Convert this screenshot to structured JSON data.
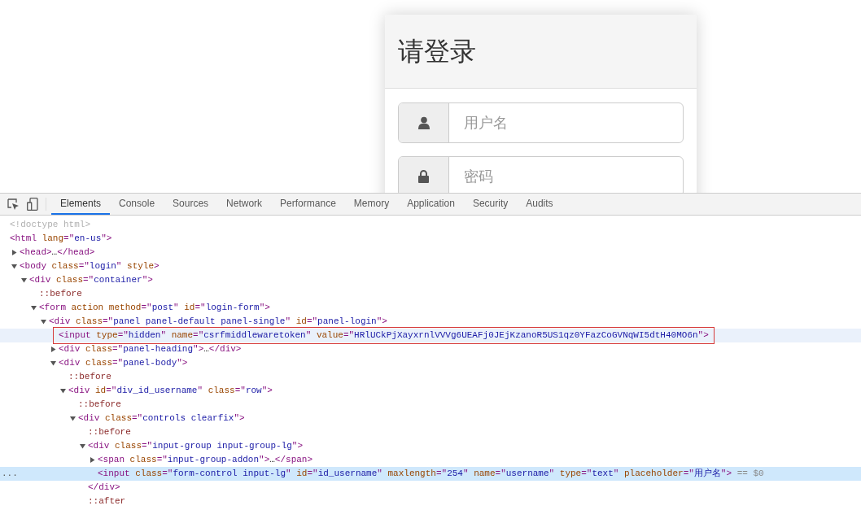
{
  "page": {
    "panel": {
      "title": "请登录",
      "fields": [
        {
          "kind": "user",
          "placeholder": "用户名"
        },
        {
          "kind": "lock",
          "placeholder": "密码"
        }
      ]
    }
  },
  "devtools": {
    "tabs": [
      {
        "label": "Elements",
        "selected": true
      },
      {
        "label": "Console",
        "selected": false
      },
      {
        "label": "Sources",
        "selected": false
      },
      {
        "label": "Network",
        "selected": false
      },
      {
        "label": "Performance",
        "selected": false
      },
      {
        "label": "Memory",
        "selected": false
      },
      {
        "label": "Application",
        "selected": false
      },
      {
        "label": "Security",
        "selected": false
      },
      {
        "label": "Audits",
        "selected": false
      }
    ],
    "tree": [
      {
        "segments": [
          {
            "kind": "comment",
            "text": "<!doctype html>"
          }
        ],
        "selected": false,
        "hovered": false,
        "outlined": false
      },
      {
        "segments": [
          {
            "kind": "tag",
            "text": "<html"
          },
          {
            "kind": "attr",
            "text": " lang"
          },
          {
            "kind": "tag",
            "text": "=\""
          },
          {
            "kind": "val",
            "text": "en-us"
          },
          {
            "kind": "tag",
            "text": "\">"
          }
        ],
        "selected": false,
        "hovered": false,
        "outlined": false,
        "children": [
          {
            "segments": [
              {
                "kind": "tag",
                "text": "<head>"
              },
              {
                "kind": "text",
                "text": "…"
              },
              {
                "kind": "tag",
                "text": "</head>"
              }
            ],
            "expanded": false,
            "selected": false,
            "hovered": false,
            "outlined": false
          },
          {
            "segments": [
              {
                "kind": "tag",
                "text": "<body"
              },
              {
                "kind": "attr",
                "text": " class"
              },
              {
                "kind": "tag",
                "text": "=\""
              },
              {
                "kind": "val",
                "text": "login"
              },
              {
                "kind": "tag",
                "text": "\""
              },
              {
                "kind": "attr",
                "text": " style"
              },
              {
                "kind": "tag",
                "text": ">"
              }
            ],
            "expanded": true,
            "selected": false,
            "hovered": false,
            "outlined": false,
            "children": [
              {
                "segments": [
                  {
                    "kind": "tag",
                    "text": "<div"
                  },
                  {
                    "kind": "attr",
                    "text": " class"
                  },
                  {
                    "kind": "tag",
                    "text": "=\""
                  },
                  {
                    "kind": "val",
                    "text": "container"
                  },
                  {
                    "kind": "tag",
                    "text": "\">"
                  }
                ],
                "expanded": true,
                "selected": false,
                "hovered": false,
                "outlined": false,
                "children": [
                  {
                    "segments": [
                      {
                        "kind": "pseudo",
                        "text": "::before"
                      }
                    ],
                    "selected": false,
                    "hovered": false,
                    "outlined": false
                  },
                  {
                    "segments": [
                      {
                        "kind": "tag",
                        "text": "<form"
                      },
                      {
                        "kind": "attr",
                        "text": " action method"
                      },
                      {
                        "kind": "tag",
                        "text": "=\""
                      },
                      {
                        "kind": "val",
                        "text": "post"
                      },
                      {
                        "kind": "tag",
                        "text": "\""
                      },
                      {
                        "kind": "attr",
                        "text": " id"
                      },
                      {
                        "kind": "tag",
                        "text": "=\""
                      },
                      {
                        "kind": "val",
                        "text": "login-form"
                      },
                      {
                        "kind": "tag",
                        "text": "\">"
                      }
                    ],
                    "expanded": true,
                    "selected": false,
                    "hovered": false,
                    "outlined": false,
                    "children": [
                      {
                        "segments": [
                          {
                            "kind": "tag",
                            "text": "<div"
                          },
                          {
                            "kind": "attr",
                            "text": " class"
                          },
                          {
                            "kind": "tag",
                            "text": "=\""
                          },
                          {
                            "kind": "val",
                            "text": "panel panel-default panel-single"
                          },
                          {
                            "kind": "tag",
                            "text": "\""
                          },
                          {
                            "kind": "attr",
                            "text": " id"
                          },
                          {
                            "kind": "tag",
                            "text": "=\""
                          },
                          {
                            "kind": "val",
                            "text": "panel-login"
                          },
                          {
                            "kind": "tag",
                            "text": "\">"
                          }
                        ],
                        "expanded": true,
                        "selected": false,
                        "hovered": false,
                        "outlined": false,
                        "children": [
                          {
                            "segments": [
                              {
                                "kind": "tag",
                                "text": "<input"
                              },
                              {
                                "kind": "attr",
                                "text": " type"
                              },
                              {
                                "kind": "tag",
                                "text": "=\""
                              },
                              {
                                "kind": "val",
                                "text": "hidden"
                              },
                              {
                                "kind": "tag",
                                "text": "\""
                              },
                              {
                                "kind": "attr",
                                "text": " name"
                              },
                              {
                                "kind": "tag",
                                "text": "=\""
                              },
                              {
                                "kind": "val",
                                "text": "csrfmiddlewaretoken"
                              },
                              {
                                "kind": "tag",
                                "text": "\""
                              },
                              {
                                "kind": "attr",
                                "text": " value"
                              },
                              {
                                "kind": "tag",
                                "text": "=\""
                              },
                              {
                                "kind": "val",
                                "text": "HRlUCkPjXayxrnlVVVg6UEAFj0JEjKzanoR5US1qz0YFazCoGVNqWI5dtH40MO6n"
                              },
                              {
                                "kind": "tag",
                                "text": "\">"
                              }
                            ],
                            "selected": false,
                            "hovered": true,
                            "outlined": true
                          },
                          {
                            "segments": [
                              {
                                "kind": "tag",
                                "text": "<div"
                              },
                              {
                                "kind": "attr",
                                "text": " class"
                              },
                              {
                                "kind": "tag",
                                "text": "=\""
                              },
                              {
                                "kind": "val",
                                "text": "panel-heading"
                              },
                              {
                                "kind": "tag",
                                "text": "\">"
                              },
                              {
                                "kind": "text",
                                "text": "…"
                              },
                              {
                                "kind": "tag",
                                "text": "</div>"
                              }
                            ],
                            "expanded": false,
                            "selected": false,
                            "hovered": false,
                            "outlined": false
                          },
                          {
                            "segments": [
                              {
                                "kind": "tag",
                                "text": "<div"
                              },
                              {
                                "kind": "attr",
                                "text": " class"
                              },
                              {
                                "kind": "tag",
                                "text": "=\""
                              },
                              {
                                "kind": "val",
                                "text": "panel-body"
                              },
                              {
                                "kind": "tag",
                                "text": "\">"
                              }
                            ],
                            "expanded": true,
                            "selected": false,
                            "hovered": false,
                            "outlined": false,
                            "children": [
                              {
                                "segments": [
                                  {
                                    "kind": "pseudo",
                                    "text": "::before"
                                  }
                                ],
                                "selected": false,
                                "hovered": false,
                                "outlined": false
                              },
                              {
                                "segments": [
                                  {
                                    "kind": "tag",
                                    "text": "<div"
                                  },
                                  {
                                    "kind": "attr",
                                    "text": " id"
                                  },
                                  {
                                    "kind": "tag",
                                    "text": "=\""
                                  },
                                  {
                                    "kind": "val",
                                    "text": "div_id_username"
                                  },
                                  {
                                    "kind": "tag",
                                    "text": "\""
                                  },
                                  {
                                    "kind": "attr",
                                    "text": " class"
                                  },
                                  {
                                    "kind": "tag",
                                    "text": "=\""
                                  },
                                  {
                                    "kind": "val",
                                    "text": "row"
                                  },
                                  {
                                    "kind": "tag",
                                    "text": "\">"
                                  }
                                ],
                                "expanded": true,
                                "selected": false,
                                "hovered": false,
                                "outlined": false,
                                "children": [
                                  {
                                    "segments": [
                                      {
                                        "kind": "pseudo",
                                        "text": "::before"
                                      }
                                    ],
                                    "selected": false,
                                    "hovered": false,
                                    "outlined": false
                                  },
                                  {
                                    "segments": [
                                      {
                                        "kind": "tag",
                                        "text": "<div"
                                      },
                                      {
                                        "kind": "attr",
                                        "text": " class"
                                      },
                                      {
                                        "kind": "tag",
                                        "text": "=\""
                                      },
                                      {
                                        "kind": "val",
                                        "text": "controls clearfix"
                                      },
                                      {
                                        "kind": "tag",
                                        "text": "\">"
                                      }
                                    ],
                                    "expanded": true,
                                    "selected": false,
                                    "hovered": false,
                                    "outlined": false,
                                    "children": [
                                      {
                                        "segments": [
                                          {
                                            "kind": "pseudo",
                                            "text": "::before"
                                          }
                                        ],
                                        "selected": false,
                                        "hovered": false,
                                        "outlined": false
                                      },
                                      {
                                        "segments": [
                                          {
                                            "kind": "tag",
                                            "text": "<div"
                                          },
                                          {
                                            "kind": "attr",
                                            "text": " class"
                                          },
                                          {
                                            "kind": "tag",
                                            "text": "=\""
                                          },
                                          {
                                            "kind": "val",
                                            "text": "input-group input-group-lg"
                                          },
                                          {
                                            "kind": "tag",
                                            "text": "\">"
                                          }
                                        ],
                                        "expanded": true,
                                        "selected": false,
                                        "hovered": false,
                                        "outlined": false,
                                        "children": [
                                          {
                                            "segments": [
                                              {
                                                "kind": "tag",
                                                "text": "<span"
                                              },
                                              {
                                                "kind": "attr",
                                                "text": " class"
                                              },
                                              {
                                                "kind": "tag",
                                                "text": "=\""
                                              },
                                              {
                                                "kind": "val",
                                                "text": "input-group-addon"
                                              },
                                              {
                                                "kind": "tag",
                                                "text": "\">"
                                              },
                                              {
                                                "kind": "text",
                                                "text": "…"
                                              },
                                              {
                                                "kind": "tag",
                                                "text": "</span>"
                                              }
                                            ],
                                            "expanded": false,
                                            "selected": false,
                                            "hovered": false,
                                            "outlined": false
                                          },
                                          {
                                            "gutter": "...",
                                            "segments": [
                                              {
                                                "kind": "tag",
                                                "text": "<input"
                                              },
                                              {
                                                "kind": "attr",
                                                "text": " class"
                                              },
                                              {
                                                "kind": "tag",
                                                "text": "=\""
                                              },
                                              {
                                                "kind": "val",
                                                "text": "form-control input-lg"
                                              },
                                              {
                                                "kind": "tag",
                                                "text": "\""
                                              },
                                              {
                                                "kind": "attr",
                                                "text": " id"
                                              },
                                              {
                                                "kind": "tag",
                                                "text": "=\""
                                              },
                                              {
                                                "kind": "val",
                                                "text": "id_username"
                                              },
                                              {
                                                "kind": "tag",
                                                "text": "\""
                                              },
                                              {
                                                "kind": "attr",
                                                "text": " maxlength"
                                              },
                                              {
                                                "kind": "tag",
                                                "text": "=\""
                                              },
                                              {
                                                "kind": "val",
                                                "text": "254"
                                              },
                                              {
                                                "kind": "tag",
                                                "text": "\""
                                              },
                                              {
                                                "kind": "attr",
                                                "text": " name"
                                              },
                                              {
                                                "kind": "tag",
                                                "text": "=\""
                                              },
                                              {
                                                "kind": "val",
                                                "text": "username"
                                              },
                                              {
                                                "kind": "tag",
                                                "text": "\""
                                              },
                                              {
                                                "kind": "attr",
                                                "text": " type"
                                              },
                                              {
                                                "kind": "tag",
                                                "text": "=\""
                                              },
                                              {
                                                "kind": "val",
                                                "text": "text"
                                              },
                                              {
                                                "kind": "tag",
                                                "text": "\""
                                              },
                                              {
                                                "kind": "attr",
                                                "text": " placeholder"
                                              },
                                              {
                                                "kind": "tag",
                                                "text": "=\""
                                              },
                                              {
                                                "kind": "val",
                                                "text": "用户名"
                                              },
                                              {
                                                "kind": "tag",
                                                "text": "\">"
                                              },
                                              {
                                                "kind": "note",
                                                "text": " == $0"
                                              }
                                            ],
                                            "selected": true,
                                            "hovered": false,
                                            "outlined": false
                                          }
                                        ]
                                      },
                                      {
                                        "segments": [
                                          {
                                            "kind": "tag",
                                            "text": "</div>"
                                          }
                                        ],
                                        "selected": false,
                                        "hovered": false,
                                        "outlined": false
                                      },
                                      {
                                        "segments": [
                                          {
                                            "kind": "pseudo",
                                            "text": "::after"
                                          }
                                        ],
                                        "selected": false,
                                        "hovered": false,
                                        "outlined": false
                                      }
                                    ]
                                  }
                                ]
                              }
                            ]
                          }
                        ]
                      }
                    ]
                  }
                ]
              }
            ]
          }
        ]
      }
    ]
  }
}
